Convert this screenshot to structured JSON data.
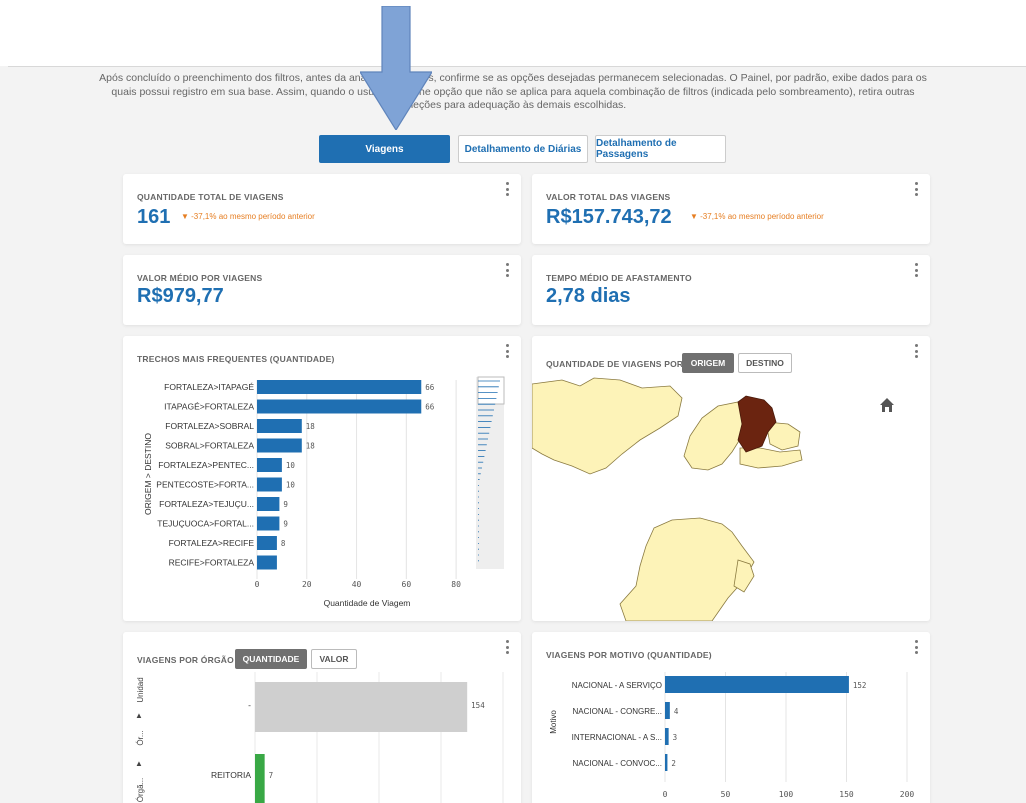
{
  "intro_text": "Após concluído o preenchimento dos filtros, antes da análise dos dados, confirme se as opções desejadas permanecem selecionadas. O Painel, por padrão, exibe dados para os quais possui registro em sua base. Assim, quando o usuário escolhe opção que não se aplica para aquela combinação de filtros (indicada pelo sombreamento), retira outras seleções para adequação às demais escolhidas.",
  "tabs": [
    {
      "label": "Viagens",
      "active": true
    },
    {
      "label": "Detalhamento de Diárias",
      "active": false
    },
    {
      "label": "Detalhamento de Passagens",
      "active": false
    }
  ],
  "kpis": {
    "total_trips": {
      "title": "QUANTIDADE TOTAL DE VIAGENS",
      "value": "161",
      "delta": "▼ -37,1% ao mesmo período anterior"
    },
    "total_value": {
      "title": "VALOR TOTAL DAS VIAGENS",
      "value": "R$157.743,72",
      "delta": "▼ -37,1% ao mesmo período anterior"
    },
    "avg_value": {
      "title": "VALOR MÉDIO POR VIAGENS",
      "value": "R$979,77"
    },
    "avg_time": {
      "title": "TEMPO MÉDIO DE AFASTAMENTO",
      "value": "2,78 dias"
    }
  },
  "map_card": {
    "title": "QUANTIDADE DE VIAGENS POR",
    "toggle_on": "ORIGEM",
    "toggle_off": "DESTINO",
    "colors": {
      "highlight": "#6b2410",
      "state": "#fdf3b8",
      "border": "#8a7a40"
    }
  },
  "organ_card": {
    "title": "VIAGENS POR ÓRGÃO",
    "toggle_on": "QUANTIDADE",
    "toggle_off": "VALOR",
    "axis_items": [
      "Unidad",
      "▲",
      "Ór...",
      "▲",
      "Órgã..."
    ]
  },
  "motivo_card": {
    "title": "VIAGENS POR MOTIVO (QUANTIDADE)"
  },
  "trechos_card": {
    "title": "TRECHOS MAIS FREQUENTES (QUANTIDADE)"
  },
  "chart_data": [
    {
      "type": "bar",
      "orientation": "horizontal",
      "categories": [
        "FORTALEZA>ITAPAGÉ",
        "ITAPAGÉ>FORTALEZA",
        "FORTALEZA>SOBRAL",
        "SOBRAL>FORTALEZA",
        "FORTALEZA>PENTEC...",
        "PENTECOSTE>FORTA...",
        "FORTALEZA>TEJUÇU...",
        "TEJUÇUOCA>FORTAL...",
        "FORTALEZA>RECIFE",
        "RECIFE>FORTALEZA"
      ],
      "values": [
        66,
        66,
        18,
        18,
        10,
        10,
        9,
        9,
        8,
        8
      ],
      "data_labels": [
        "66",
        "66",
        "18",
        "18",
        "10",
        "10",
        "9",
        "9",
        "8",
        ""
      ],
      "ticks": [
        "0",
        "20",
        "40",
        "60",
        "80"
      ],
      "xlim": [
        0,
        90
      ],
      "xlabel": "Quantidade de Viagem",
      "ylabel": "ORIGEM > DESTINO",
      "color": "#1f6fb2"
    },
    {
      "type": "bar",
      "orientation": "horizontal",
      "categories": [
        "-",
        "REITORIA"
      ],
      "values": [
        154,
        7
      ],
      "data_labels": [
        "154",
        "7"
      ],
      "colors": [
        "#cfcfcf",
        "#39a845"
      ],
      "xlim": [
        0,
        180
      ]
    },
    {
      "type": "bar",
      "orientation": "horizontal",
      "categories": [
        "NACIONAL - A SERVIÇO",
        "NACIONAL - CONGRE...",
        "INTERNACIONAL - A S...",
        "NACIONAL - CONVOC..."
      ],
      "values": [
        152,
        4,
        3,
        2
      ],
      "data_labels": [
        "152",
        "4",
        "3",
        "2"
      ],
      "ticks": [
        "0",
        "50",
        "100",
        "150",
        "200"
      ],
      "xlim": [
        0,
        200
      ],
      "ylabel": "Motivo",
      "color": "#1f6fb2"
    }
  ]
}
